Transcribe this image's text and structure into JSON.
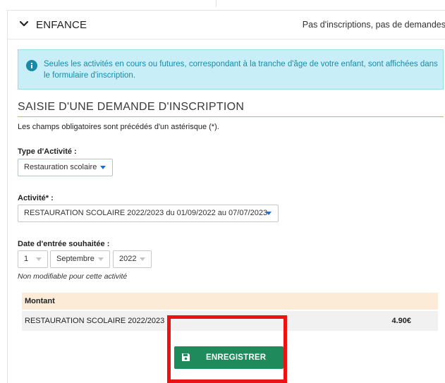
{
  "section": {
    "title": "ENFANCE",
    "status": "Pas d'inscriptions, pas de demandes"
  },
  "info_banner": {
    "text": "Seules les activités en cours ou futures, correspondant à la tranche d'âge de votre enfant, sont affichées dans le formulaire d'inscription."
  },
  "form": {
    "title": "SAISIE D'UNE DEMANDE D'INSCRIPTION",
    "required_note": "Les champs obligatoires sont précédés d'un astérisque (*).",
    "activity_type": {
      "label": "Type d'Activité :",
      "value": "Restauration scolaire"
    },
    "activity": {
      "label": "Activité* :",
      "value": "RESTAURATION SCOLAIRE 2022/2023 du 01/09/2022 au 07/07/2023"
    },
    "start_date": {
      "label": "Date d'entrée souhaitée :",
      "day": "1",
      "month": "Septembre",
      "year": "2022",
      "note": "Non modifiable pour cette activité"
    },
    "amount_table": {
      "header": "Montant",
      "rows": [
        {
          "label": "RESTAURATION SCOLAIRE 2022/2023",
          "amount": "4.90€"
        }
      ]
    },
    "save_label": "ENREGISTRER"
  },
  "colors": {
    "info_bg": "#c8eef7",
    "info_text": "#1a8aa8",
    "save_button": "#1f8a5b",
    "table_header": "#fcecd7",
    "highlight": "#ee1111"
  },
  "icons": {
    "collapse": "chevron-down-icon",
    "info": "info-icon",
    "save": "floppy-disk-icon",
    "dropdown": "caret-down-icon"
  }
}
